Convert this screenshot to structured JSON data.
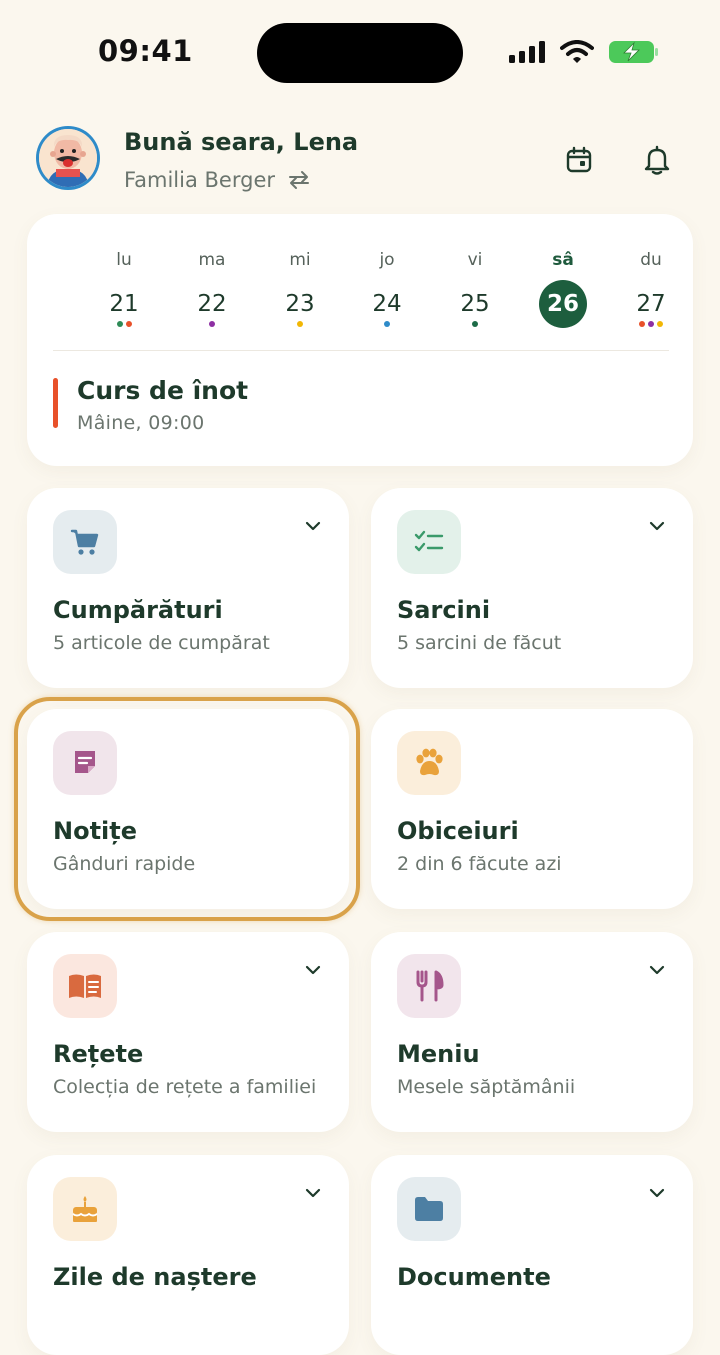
{
  "status": {
    "time": "09:41"
  },
  "header": {
    "greeting": "Bună seara, Lena",
    "family": "Familia Berger"
  },
  "calendar": {
    "days": [
      {
        "name": "lu",
        "num": "21",
        "dots": [
          "#2E8B57",
          "#E8512A"
        ]
      },
      {
        "name": "ma",
        "num": "22",
        "dots": [
          "#8E2FA3"
        ]
      },
      {
        "name": "mi",
        "num": "23",
        "dots": [
          "#F2B705"
        ]
      },
      {
        "name": "jo",
        "num": "24",
        "dots": [
          "#2E8BC9"
        ]
      },
      {
        "name": "vi",
        "num": "25",
        "dots": [
          "#1D6B47"
        ]
      },
      {
        "name": "sâ",
        "num": "26",
        "dots": [],
        "selected": true
      },
      {
        "name": "du",
        "num": "27",
        "dots": [
          "#E8512A",
          "#8E2FA3",
          "#F2B705"
        ]
      }
    ],
    "event": {
      "title": "Curs de înot",
      "time": "Mâine, 09:00",
      "color": "#E8512A"
    }
  },
  "tiles": [
    {
      "title": "Cumpărături",
      "subtitle": "5 articole de cumpărat",
      "icon": "cart-icon",
      "icon_bg": "#E5ECEF",
      "icon_color": "#4D7FA3",
      "chevron": true
    },
    {
      "title": "Sarcini",
      "subtitle": "5 sarcini de făcut",
      "icon": "checklist-icon",
      "icon_bg": "#E3F1EA",
      "icon_color": "#3A9A6A",
      "chevron": true
    },
    {
      "title": "Notițe",
      "subtitle": "Gânduri rapide",
      "icon": "note-icon",
      "icon_bg": "#F1E5EB",
      "icon_color": "#A5568B",
      "chevron": false
    },
    {
      "title": "Obiceiuri",
      "subtitle": "2 din 6 făcute azi",
      "icon": "paw-icon",
      "icon_bg": "#FBEEDB",
      "icon_color": "#E9A23B",
      "chevron": false
    },
    {
      "title": "Rețete",
      "subtitle": "Colecția de rețete a familiei",
      "icon": "book-icon",
      "icon_bg": "#FBE7DF",
      "icon_color": "#D96A3F",
      "chevron": true
    },
    {
      "title": "Meniu",
      "subtitle": "Mesele săptămânii",
      "icon": "cutlery-icon",
      "icon_bg": "#F2E5EC",
      "icon_color": "#A5568B",
      "chevron": true
    },
    {
      "title": "Zile de naștere",
      "subtitle": "",
      "icon": "cake-icon",
      "icon_bg": "#FBEEDB",
      "icon_color": "#E9A23B",
      "chevron": true
    },
    {
      "title": "Documente",
      "subtitle": "",
      "icon": "folder-icon",
      "icon_bg": "#E5ECEF",
      "icon_color": "#4D7FA3",
      "chevron": true
    }
  ]
}
